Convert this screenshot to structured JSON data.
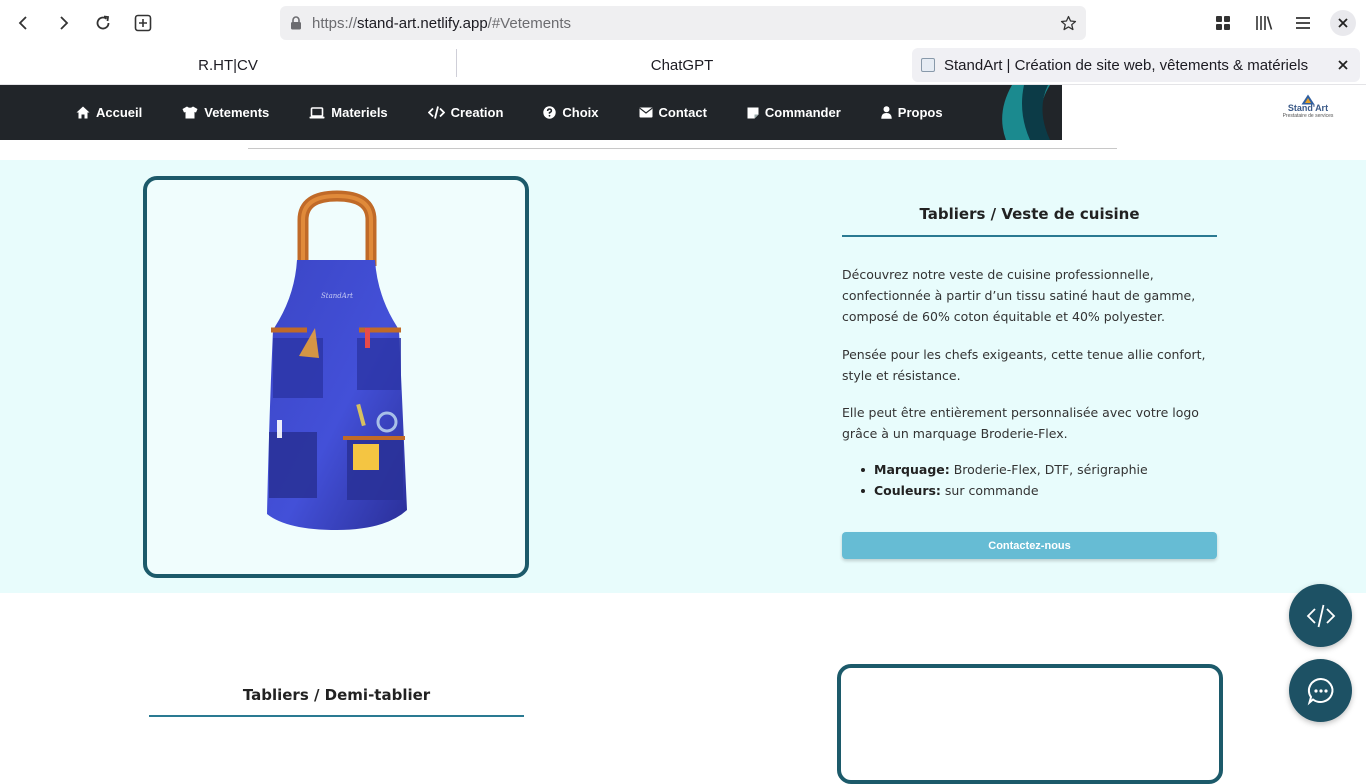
{
  "browser": {
    "url_scheme": "https://",
    "url_host": "stand-art.netlify.app",
    "url_path": "/#Vetements",
    "tabs": [
      {
        "title": "R.HT|CV"
      },
      {
        "title": "ChatGPT"
      },
      {
        "title": "StandArt | Création de site web, vêtements & matériels"
      }
    ]
  },
  "nav": {
    "items": [
      {
        "label": "Accueil",
        "icon": "home-icon"
      },
      {
        "label": "Vetements",
        "icon": "shirt-icon"
      },
      {
        "label": "Materiels",
        "icon": "laptop-icon"
      },
      {
        "label": "Creation",
        "icon": "code-icon"
      },
      {
        "label": "Choix",
        "icon": "question-icon"
      },
      {
        "label": "Contact",
        "icon": "envelope-icon"
      },
      {
        "label": "Commander",
        "icon": "note-icon"
      },
      {
        "label": "Propos",
        "icon": "user-icon"
      }
    ],
    "logo_name": "Stand'Art",
    "logo_sub": "Prestataire de services"
  },
  "product1": {
    "title": "Tabliers / Veste de cuisine",
    "p1": "Découvrez notre veste de cuisine professionnelle, confectionnée à partir d’un tissu satiné haut de gamme, composé de 60% coton équitable et 40% polyester.",
    "p2": "Pensée pour les chefs exigeants, cette tenue allie confort, style et résistance.",
    "p3": "Elle peut être entièrement personnalisée avec votre logo grâce à un marquage Broderie-Flex.",
    "bullets": [
      {
        "label": "Marquage:",
        "value": " Broderie-Flex, DTF, sérigraphie"
      },
      {
        "label": "Couleurs:",
        "value": " sur commande"
      }
    ],
    "cta": "Contactez-nous"
  },
  "product2": {
    "title": "Tabliers / Demi-tablier"
  },
  "colors": {
    "nav_bg": "#212529",
    "section_bg": "#e8fcfc",
    "frame": "#1c5a6a",
    "cta": "#66bcd4",
    "fab": "#1d5164"
  },
  "fabs": [
    {
      "icon": "code-icon"
    },
    {
      "icon": "chat-icon"
    }
  ]
}
